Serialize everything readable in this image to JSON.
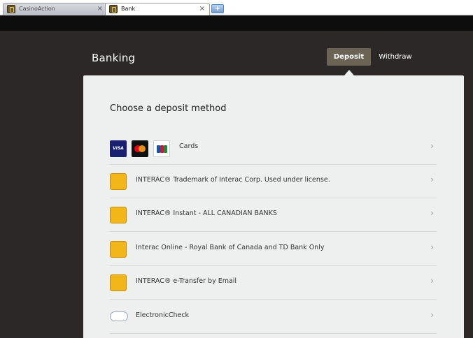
{
  "browser": {
    "tabs": [
      {
        "label": "CasinoAction",
        "close": "×"
      },
      {
        "label": "Bank",
        "close": "×"
      }
    ],
    "new_tab_symbol": "+"
  },
  "header": {
    "title": "Banking",
    "deposit_label": "Deposit",
    "withdraw_label": "Withdraw"
  },
  "panel": {
    "title": "Choose a deposit method",
    "methods": [
      {
        "label": "Cards",
        "icons": [
          "visa-icon",
          "mastercard-icon",
          "jcb-icon"
        ],
        "card_text": {
          "visa": "VISA"
        }
      },
      {
        "label": "INTERAC® Trademark of Interac Corp. Used under license.",
        "icon": "interac-icon"
      },
      {
        "label": "INTERAC® Instant - ALL CANADIAN BANKS",
        "icon": "interac-icon"
      },
      {
        "label": "Interac Online - Royal Bank of Canada and TD Bank Only",
        "icon": "interac-icon"
      },
      {
        "label": "INTERAC® e-Transfer by Email",
        "icon": "interac-icon"
      },
      {
        "label": "ElectronicCheck",
        "icon": "echeck-icon"
      }
    ],
    "chevron": "›"
  },
  "colors": {
    "page_bg": "#2b2827",
    "topbar": "#0d0d0d",
    "panel_bg": "#eef0f0",
    "deposit_active": "#6b6455",
    "interac_yellow": "#f2b61b"
  }
}
